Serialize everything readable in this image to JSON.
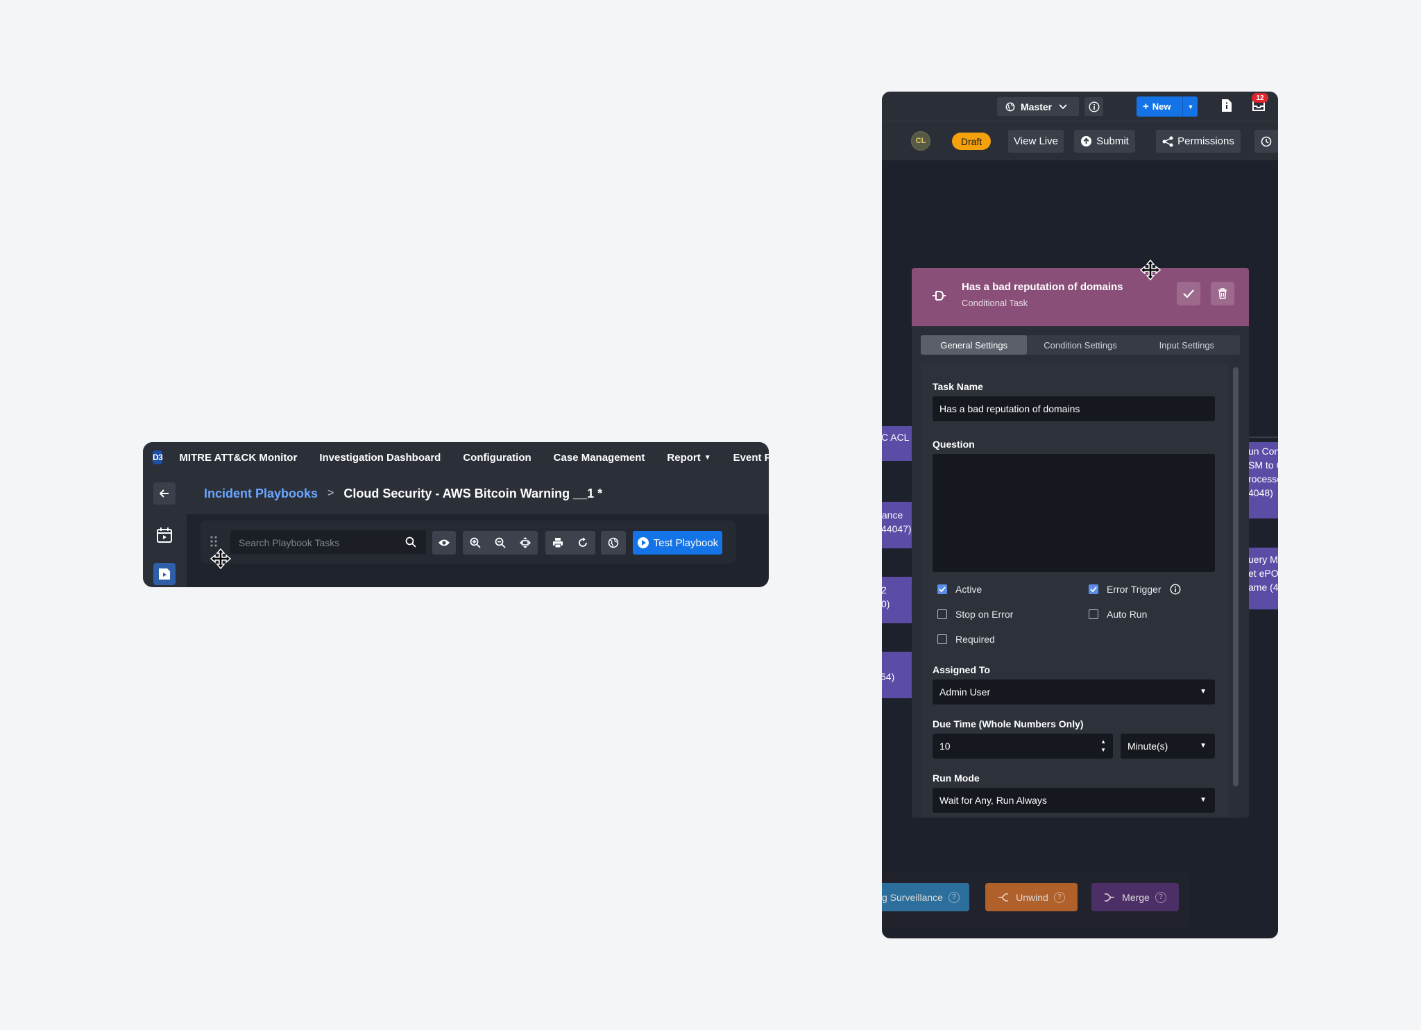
{
  "colors": {
    "accent_blue": "#1473e6",
    "draft_orange": "#f4a10b",
    "task_header": "#8a4f79",
    "node_purple": "#5b4da6",
    "link_blue": "#6aa6ff"
  },
  "left": {
    "logo": "D3",
    "nav": [
      "MITRE ATT&CK Monitor",
      "Investigation Dashboard",
      "Configuration",
      "Case Management",
      "Report",
      "Event Pl"
    ],
    "breadcrumb": {
      "parent": "Incident Playbooks",
      "separator": ">",
      "current": "Cloud Security - AWS Bitcoin Warning __1 *"
    },
    "search": {
      "placeholder": "Search Playbook Tasks",
      "value": ""
    },
    "toolbar_icons": [
      "eye-icon",
      "zoom-in-icon",
      "zoom-out-icon",
      "fit-screen-icon",
      "print-icon",
      "refresh-icon",
      "globe-icon"
    ],
    "test_button": "Test Playbook"
  },
  "right": {
    "header": {
      "master_label": "Master",
      "new_label": "New",
      "notification_count": "12",
      "avatar_initials": "CL",
      "draft": "Draft",
      "view_live": "View Live",
      "submit": "Submit",
      "permissions": "Permissions"
    },
    "canvas_nodes": [
      {
        "lines": [
          "C ACL"
        ]
      },
      {
        "lines": [
          "tance",
          "44047)"
        ]
      },
      {
        "lines": [
          "2",
          "0)"
        ]
      },
      {
        "lines": [
          "54)"
        ]
      },
      {
        "lines": [
          "un Con",
          "SM to G",
          "rocesse",
          "4048)"
        ]
      },
      {
        "lines": [
          "uery M",
          "et ePO",
          "ame (4"
        ]
      }
    ],
    "task": {
      "title": "Has a bad reputation of domains",
      "subtitle": "Conditional Task",
      "tabs": [
        "General Settings",
        "Condition Settings",
        "Input Settings"
      ],
      "active_tab": 0,
      "task_name_label": "Task Name",
      "task_name_value": "Has a bad reputation of domains",
      "question_label": "Question",
      "question_value": "",
      "checkboxes": [
        {
          "label": "Active",
          "checked": true
        },
        {
          "label": "Error Trigger",
          "checked": true
        },
        {
          "label": "Stop on Error",
          "checked": false
        },
        {
          "label": "Auto Run",
          "checked": false
        },
        {
          "label": "Required",
          "checked": false
        }
      ],
      "assigned_to_label": "Assigned To",
      "assigned_to_value": "Admin User",
      "due_time_label": "Due Time (Whole Numbers Only)",
      "due_time_value": "10",
      "due_unit": "Minute(s)",
      "run_mode_label": "Run Mode",
      "run_mode_value": "Wait for Any, Run Always"
    },
    "bottom_buttons": {
      "surveillance": "g Surveillance",
      "unwind": "Unwind",
      "merge": "Merge",
      "help": "?"
    }
  }
}
